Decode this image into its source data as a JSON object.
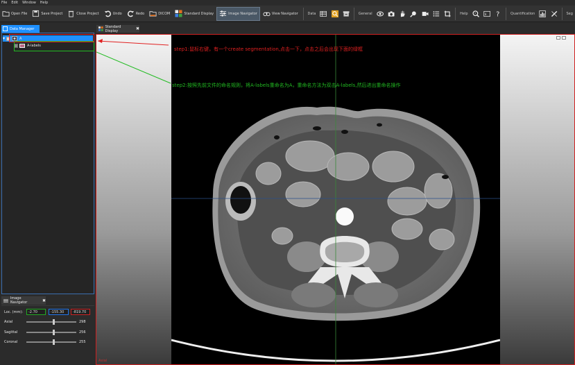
{
  "menu": [
    "File",
    "Edit",
    "Window",
    "Help"
  ],
  "toolbar": {
    "open_file": "Open File",
    "save_project": "Save Project",
    "close_project": "Close Project",
    "undo": "Undo",
    "redo": "Redo",
    "dicom": "DICOM",
    "standard_display": "Standard Display",
    "image_navigator": "Image Navigator",
    "view_navigator": "View Navigator",
    "data_label": "Data",
    "general_label": "General",
    "help_label": "Help",
    "quantification_label": "Quantification",
    "segmentation_label": "Seg"
  },
  "data_manager": {
    "tab": "Data Manager",
    "items": [
      {
        "label": "A"
      },
      {
        "label": "A-labels"
      }
    ]
  },
  "image_navigator": {
    "tab": "Image Navigator",
    "loc_label": "Loc. (mm):",
    "loc": [
      "-2.70",
      "-155.30",
      "-819.70"
    ],
    "sliders": [
      {
        "name": "Axial",
        "value": "298",
        "level": 0.55
      },
      {
        "name": "Sagittal",
        "value": "256",
        "level": 0.55
      },
      {
        "name": "Coronal",
        "value": "255",
        "level": 0.55
      }
    ]
  },
  "viewer": {
    "tab": "Standard Display",
    "corner": "Axial",
    "step1": "step1:鼠标右键，有一个create segmentation,点击一下，点击之后会出现下面的绿框",
    "step2": "step2:按照先前文件的命名规则，将A-labels重命名为A，重命名方法为双击A-labels,然后进出重命名操作"
  },
  "colors": {
    "accent": "#1e90ff",
    "annotation_red": "#e02020",
    "annotation_green": "#22bb22",
    "loc_x_border": "#22aa22",
    "loc_y_border": "#2277ee",
    "loc_z_border": "#cc2222"
  }
}
